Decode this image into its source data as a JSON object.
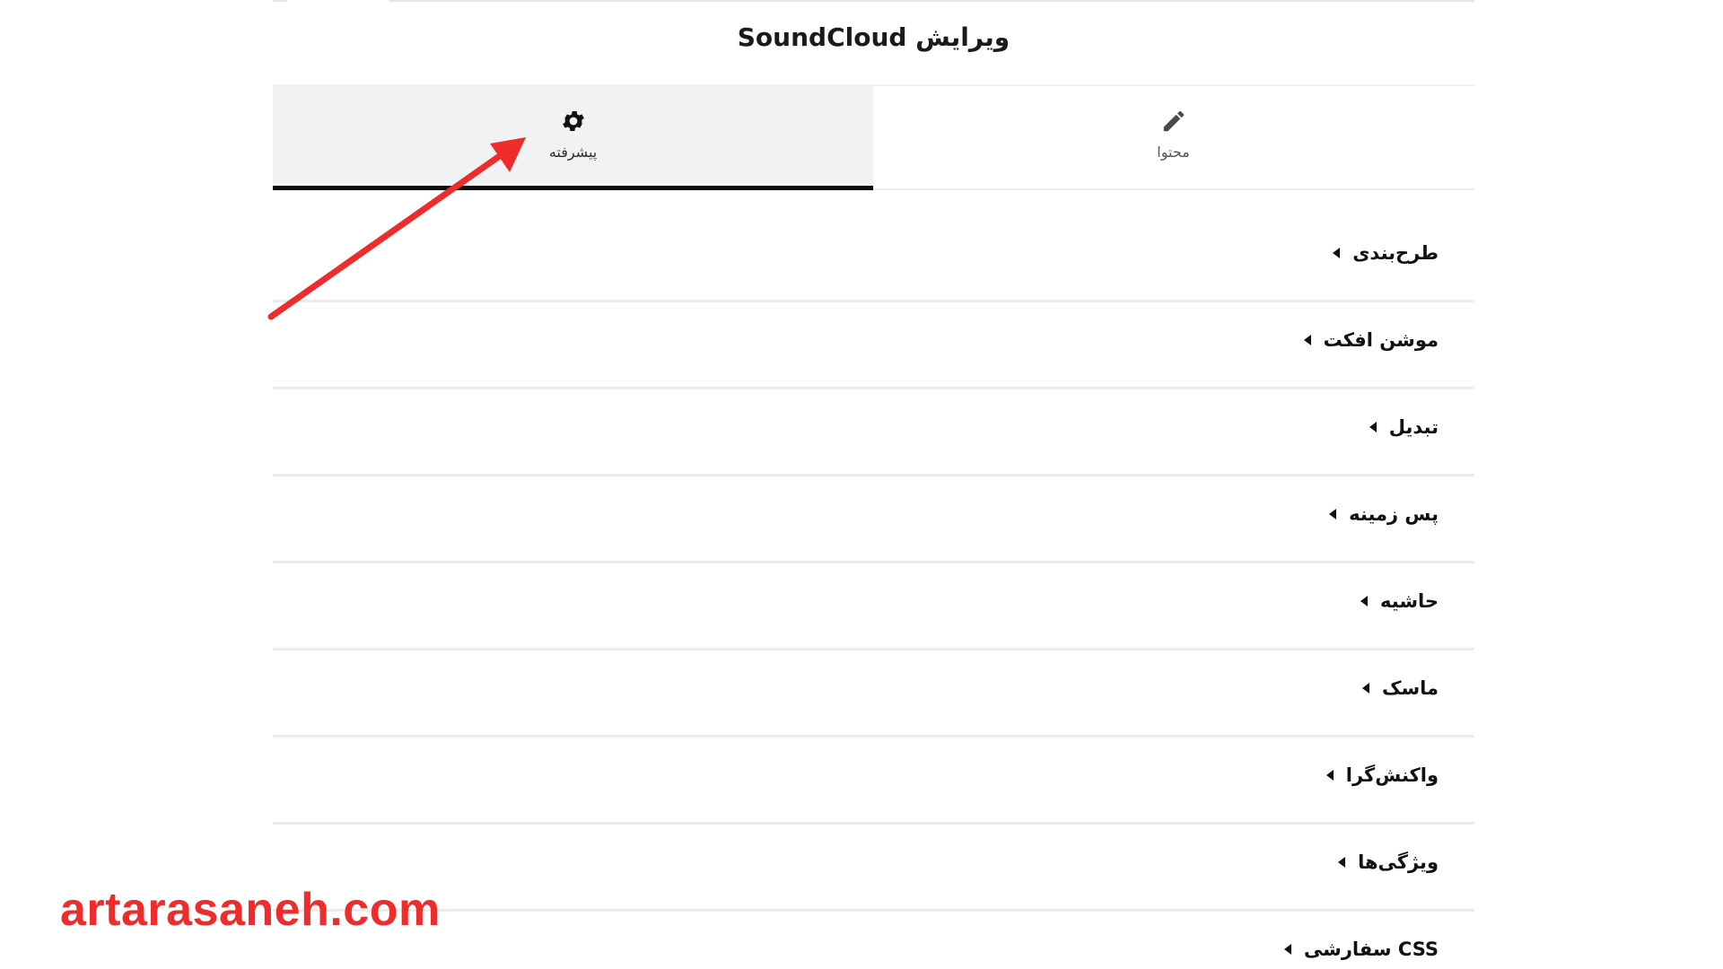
{
  "panel": {
    "title": "ویرایش SoundCloud"
  },
  "tabs": [
    {
      "label": "پیشرفته",
      "icon": "gear-icon",
      "active": true
    },
    {
      "label": "محتوا",
      "icon": "pencil-icon",
      "active": false
    }
  ],
  "sections": [
    {
      "title": "طرح‌بندی"
    },
    {
      "title": "موشن افکت"
    },
    {
      "title": "تبدیل"
    },
    {
      "title": "پس زمینه"
    },
    {
      "title": "حاشیه"
    },
    {
      "title": "ماسک"
    },
    {
      "title": "واکنش‌گرا"
    },
    {
      "title": "ویژگی‌ها"
    },
    {
      "title": "CSS سفارشی"
    }
  ],
  "annotation": {
    "arrow_color": "#ee2c2c"
  },
  "watermark": {
    "text": "artarasaneh.com"
  },
  "colors": {
    "active_tab_bg": "#f1f2f3",
    "active_tab_underline": "#0c0c0c",
    "divider": "#ececec",
    "watermark": "#ee2c2c"
  }
}
